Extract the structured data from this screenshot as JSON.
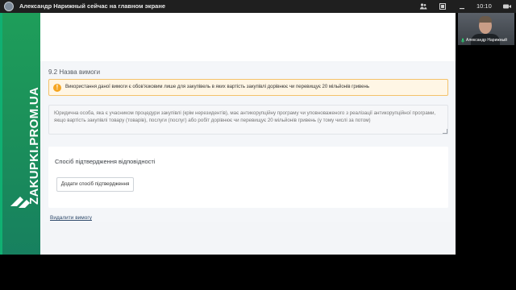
{
  "meeting": {
    "presenter_title": "Александр Нарижный сейчас на главном экране",
    "clock": "10:10",
    "participant_name": "Александр Нарижный"
  },
  "brand": {
    "wordmark": "ZAKUPKI.PROM.UA"
  },
  "form": {
    "section_title": "9.2 Назва вимоги",
    "alert_icon": "!",
    "alert_text": "Використання даної вимоги є обов'язковим лише для закупівель в яких вартість закупівлі дорівнює чи перевищує 20 мільйонів гривень",
    "textarea_placeholder": "Юридична особа, яка є учасником процедури закупівлі (крім нерезидентів), має антикорупційну програму чи уповноваженого з реалізації антикорупційної програми, якщо вартість закупівлі товару (товарів), послуги (послуг) або робіт дорівнює чи перевищує 20 мільйонів гривень (у тому числі за потом)",
    "confirmation_label": "Спосіб підтвердження відповідності",
    "add_confirmation_button": "Додати спосіб підтвердження",
    "delete_link": "Видалити вимогу"
  },
  "icons": {
    "topbar": [
      "user-avatar-icon",
      "people-icon",
      "fullscreen-icon",
      "minimize-icon",
      "video-camera-icon"
    ],
    "alert": "warning-icon",
    "mic": "microphone-icon"
  },
  "colors": {
    "brand_green": "#1b8f5a",
    "alert_bg": "#fff6e5",
    "alert_border": "#f3c26b",
    "alert_icon": "#f5a623",
    "topbar": "#1f1f1f"
  }
}
